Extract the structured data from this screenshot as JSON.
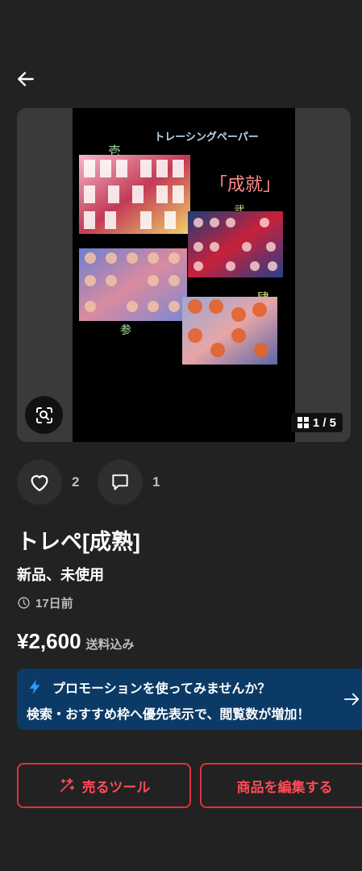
{
  "header": {
    "back_icon": "arrow-left-icon"
  },
  "gallery": {
    "image_texts": {
      "top_caption": "トレーシングペーパー",
      "center_label": "「成就」",
      "label_1": "壱",
      "label_2": "弐",
      "label_3": "参",
      "label_4": "肆"
    },
    "counter": "1 / 5",
    "lens_icon": "image-search-icon",
    "counter_icon": "grid-icon"
  },
  "engagement": {
    "likes": "2",
    "comments": "1",
    "like_icon": "heart-icon",
    "comment_icon": "comment-icon"
  },
  "product": {
    "title": "トレペ[成熟]",
    "condition": "新品、未使用",
    "posted": "17日前",
    "price": "¥2,600",
    "price_note": "送料込み"
  },
  "promo": {
    "title": "プロモーションを使ってみませんか？",
    "body": "検索・おすすめ枠へ優先表示で、閲覧数が増加！",
    "icon": "lightning-icon",
    "arrow_icon": "arrow-right-icon",
    "accent": "#0b3a66"
  },
  "buttons": {
    "sell_tool": "売るツール",
    "edit_item": "商品を編集する",
    "sell_icon": "sparkle-wand-icon",
    "accent": "#e0323c"
  }
}
